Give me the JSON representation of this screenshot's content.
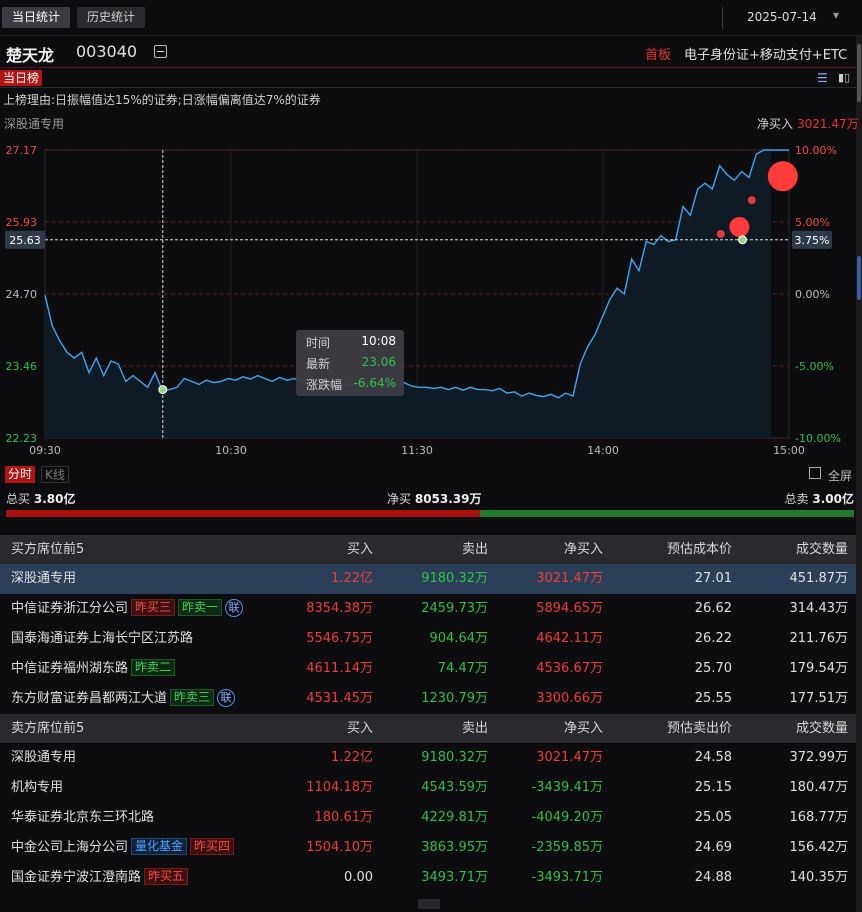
{
  "tabs": {
    "today": "当日统计",
    "history": "历史统计"
  },
  "date": "2025-07-14",
  "stock": {
    "name": "楚天龙",
    "code": "003040",
    "board": "首板",
    "concepts": "电子身份证+移动支付+ETC"
  },
  "list_tag": "当日榜",
  "reason": "上榜理由:日振幅值达15%的证券;日涨幅偏离值达7%的证券",
  "chart_header": {
    "seat": "深股通专用",
    "net_label": "净买入",
    "net_value": "3021.47万"
  },
  "chart_data": {
    "type": "line",
    "x_ticks": [
      "09:30",
      "10:30",
      "11:30",
      "14:00",
      "15:00"
    ],
    "y_left_ticks": [
      "27.17",
      "25.93",
      "24.70",
      "23.46",
      "22.23"
    ],
    "y_right_ticks": [
      "10.00%",
      "5.00%",
      "0.00%",
      "-5.00%",
      "-10.00%"
    ],
    "ylim": [
      22.23,
      27.17
    ],
    "prev_close": 24.7,
    "crosshair_price": "25.63",
    "crosshair_pct": "3.75%",
    "price_series": [
      24.68,
      24.15,
      23.9,
      23.7,
      23.6,
      23.7,
      23.35,
      23.6,
      23.3,
      23.55,
      23.5,
      23.2,
      23.3,
      23.2,
      23.1,
      23.35,
      23.05,
      23.06,
      23.1,
      23.25,
      23.2,
      23.15,
      23.22,
      23.18,
      23.2,
      23.25,
      23.22,
      23.28,
      23.24,
      23.3,
      23.25,
      23.2,
      23.27,
      23.22,
      23.25,
      23.2,
      23.23,
      23.22,
      23.2,
      23.18,
      23.1,
      23.16,
      23.14,
      23.2,
      23.15,
      23.18,
      23.12,
      23.16,
      23.12,
      23.18,
      23.12,
      23.1,
      23.1,
      23.08,
      23.1,
      23.06,
      23.1,
      23.05,
      23.1,
      23.06,
      23.06,
      23.04,
      23.08,
      23.0,
      23.02,
      22.95,
      23.0,
      22.96,
      22.94,
      22.98,
      22.92,
      23.0,
      22.95,
      23.5,
      23.8,
      24.0,
      24.3,
      24.6,
      24.8,
      24.7,
      25.3,
      25.1,
      25.6,
      25.55,
      25.7,
      25.6,
      25.63,
      26.2,
      26.05,
      26.5,
      26.6,
      26.5,
      26.9,
      26.75,
      26.65,
      26.8,
      26.7,
      27.1,
      27.17,
      27.17
    ],
    "markers": [
      {
        "label": "10:08",
        "value": 23.06,
        "color": "#9ed58a"
      },
      {
        "label": "14:38",
        "value": 25.73,
        "color": "#e23b3b"
      },
      {
        "label": "14:44",
        "value": 25.85,
        "color": "#ff3b3b"
      },
      {
        "label": "14:45",
        "value": 25.63,
        "color": "#9ed58a"
      },
      {
        "label": "14:48",
        "value": 26.31,
        "color": "#e23b3b"
      },
      {
        "label": "14:58",
        "value": 26.72,
        "color": "#ff3b3b"
      }
    ]
  },
  "tooltip": {
    "time_label": "时间",
    "time_value": "10:08",
    "price_label": "最新",
    "price_value": "23.06",
    "pct_label": "涨跌幅",
    "pct_value": "-6.64%"
  },
  "mode": {
    "fenshi": "分时",
    "kline": "K线",
    "fullscreen": "全屏"
  },
  "totals": {
    "buy_label": "总买",
    "buy_value": "3.80亿",
    "net_label": "净买",
    "net_value": "8053.39万",
    "sell_label": "总卖",
    "sell_value": "3.00亿",
    "buy_ratio": 0.559
  },
  "buy_table": {
    "headers": [
      "买方席位前5",
      "买入",
      "卖出",
      "净买入",
      "预估成本价",
      "成交数量"
    ],
    "rows": [
      {
        "name": "深股通专用",
        "badges": [],
        "lian": "",
        "buy": "1.22亿",
        "sell": "9180.32万",
        "net": "3021.47万",
        "price": "27.01",
        "vol": "451.87万"
      },
      {
        "name": "中信证券浙江分公司",
        "badges": [
          {
            "text": "昨买三",
            "style": "b-red"
          },
          {
            "text": "昨卖一",
            "style": "b-green"
          }
        ],
        "lian": "联",
        "buy": "8354.38万",
        "sell": "2459.73万",
        "net": "5894.65万",
        "price": "26.62",
        "vol": "314.43万"
      },
      {
        "name": "国泰海通证券上海长宁区江苏路",
        "badges": [],
        "lian": "",
        "buy": "5546.75万",
        "sell": "904.64万",
        "net": "4642.11万",
        "price": "26.22",
        "vol": "211.76万"
      },
      {
        "name": "中信证券福州湖东路",
        "badges": [
          {
            "text": "昨卖二",
            "style": "b-green"
          }
        ],
        "lian": "",
        "buy": "4611.14万",
        "sell": "74.47万",
        "net": "4536.67万",
        "price": "25.70",
        "vol": "179.54万"
      },
      {
        "name": "东方财富证券昌都两江大道",
        "badges": [
          {
            "text": "昨卖三",
            "style": "b-green"
          }
        ],
        "lian": "联",
        "buy": "4531.45万",
        "sell": "1230.79万",
        "net": "3300.66万",
        "price": "25.55",
        "vol": "177.51万"
      }
    ]
  },
  "sell_table": {
    "headers": [
      "卖方席位前5",
      "买入",
      "卖出",
      "净买入",
      "预估卖出价",
      "成交数量"
    ],
    "rows": [
      {
        "name": "深股通专用",
        "badges": [],
        "lian": "",
        "buy": "1.22亿",
        "sell": "9180.32万",
        "net": "3021.47万",
        "price": "24.58",
        "vol": "372.99万"
      },
      {
        "name": "机构专用",
        "badges": [],
        "lian": "",
        "buy": "1104.18万",
        "sell": "4543.59万",
        "net": "-3439.41万",
        "price": "25.15",
        "vol": "180.47万"
      },
      {
        "name": "华泰证券北京东三环北路",
        "badges": [],
        "lian": "",
        "buy": "180.61万",
        "sell": "4229.81万",
        "net": "-4049.20万",
        "price": "25.05",
        "vol": "168.77万"
      },
      {
        "name": "中金公司上海分公司",
        "badges": [
          {
            "text": "量化基金",
            "style": "b-blue"
          },
          {
            "text": "昨买四",
            "style": "b-red"
          }
        ],
        "lian": "",
        "buy": "1504.10万",
        "sell": "3863.95万",
        "net": "-2359.85万",
        "price": "24.69",
        "vol": "156.42万"
      },
      {
        "name": "国金证券宁波江澄南路",
        "badges": [
          {
            "text": "昨买五",
            "style": "b-red"
          }
        ],
        "lian": "",
        "buy": "0.00",
        "sell": "3493.71万",
        "net": "-3493.71万",
        "price": "24.88",
        "vol": "140.35万"
      }
    ]
  }
}
